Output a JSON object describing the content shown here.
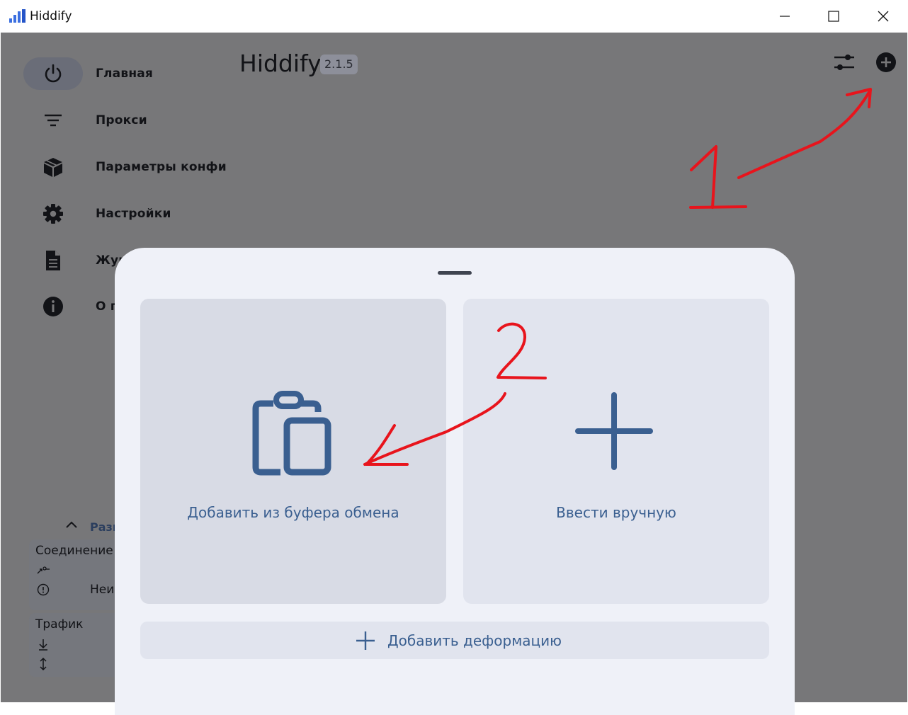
{
  "window": {
    "title": "Hiddify"
  },
  "app": {
    "name": "Hiddify",
    "version": "2.1.5"
  },
  "nav": {
    "items": [
      {
        "label": "Главная",
        "icon": "power-icon",
        "active": true
      },
      {
        "label": "Прокси",
        "icon": "filter-list-icon"
      },
      {
        "label": "Параметры конфи",
        "icon": "cube-icon"
      },
      {
        "label": "Настройки",
        "icon": "gear-icon"
      },
      {
        "label": "Жур",
        "icon": "document-icon"
      },
      {
        "label": "О п",
        "icon": "info-icon"
      }
    ]
  },
  "side_panel": {
    "expand_label": "Разв",
    "connection_title": "Соединение",
    "connection_status": "Неиз",
    "traffic_title": "Трафик"
  },
  "sheet": {
    "clipboard_label": "Добавить из буфера обмена",
    "manual_label": "Ввести вручную",
    "add_warp_label": "Добавить деформацию"
  },
  "annotations": {
    "first": "1",
    "second": "2"
  },
  "colors": {
    "accent": "#3a5f90",
    "annotation": "#e8141c",
    "overlay": "#777779",
    "sheet": "#eff1f8"
  }
}
